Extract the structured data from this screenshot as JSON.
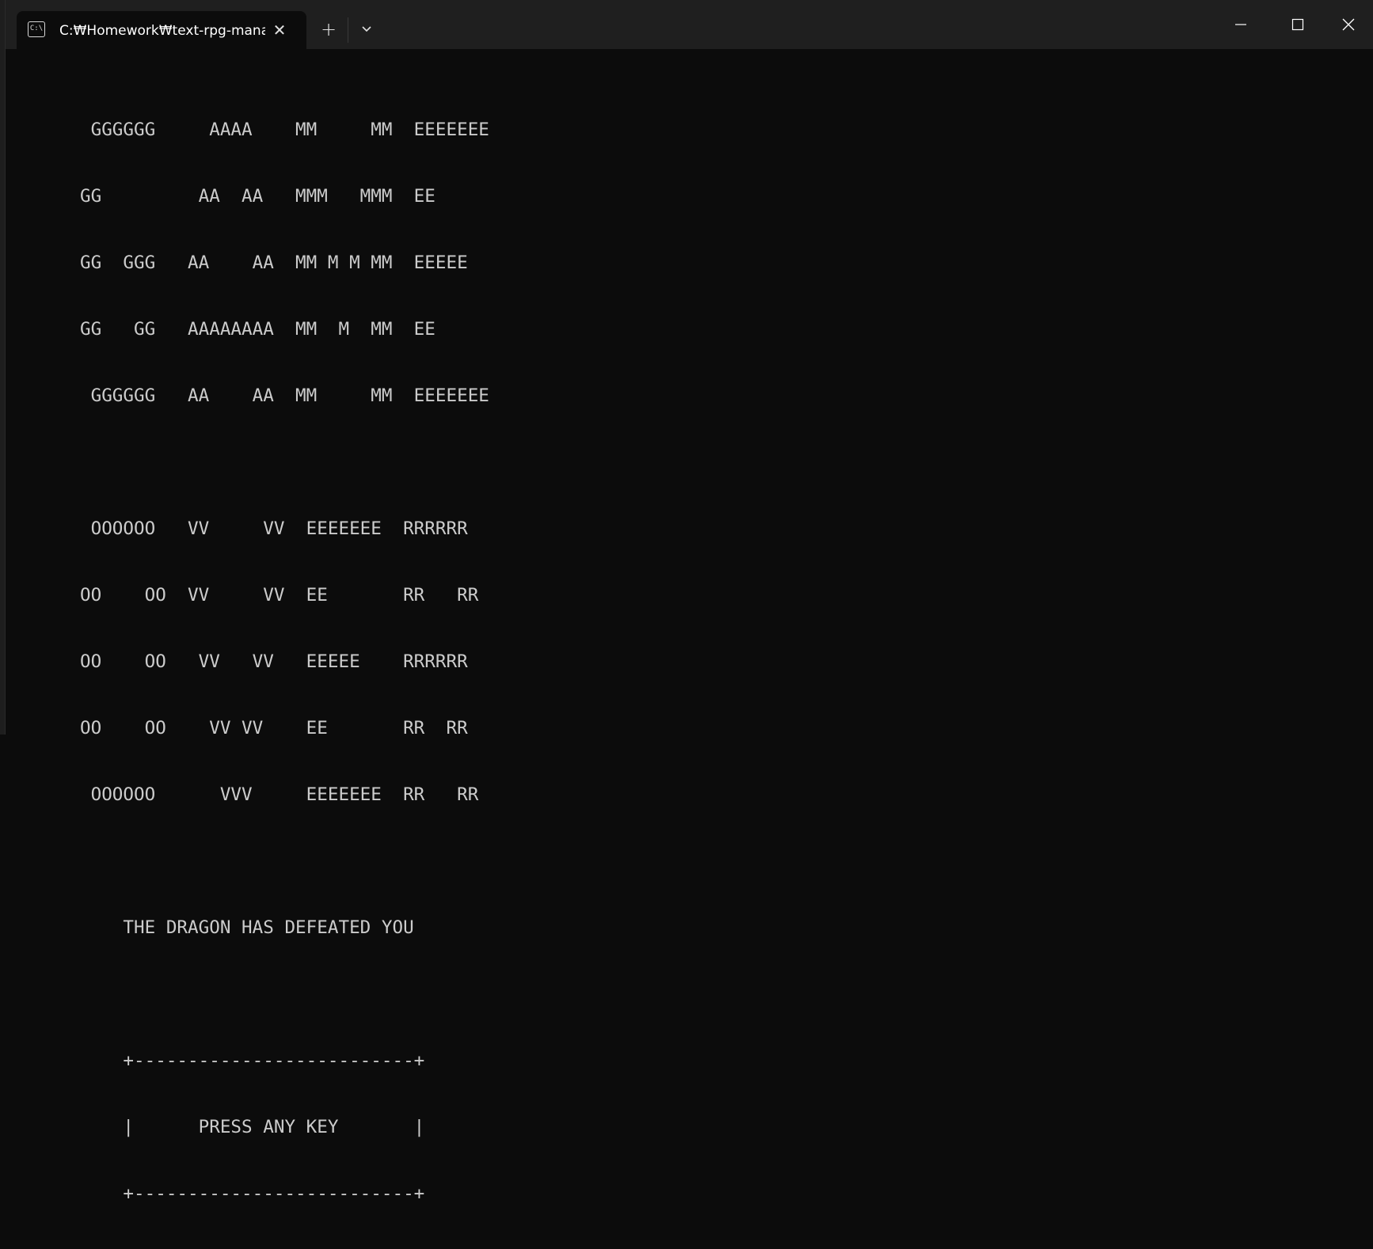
{
  "window": {
    "tab_title": "C:₩Homework₩text-rpg-manager",
    "tab_icon_text": "C:\\",
    "new_tab_label": "+",
    "close_tab_label": "✕"
  },
  "icons": {
    "tab": "terminal-icon",
    "close_tab": "close-icon",
    "new_tab": "plus-icon",
    "dropdown": "chevron-down-icon",
    "minimize": "minimize-icon",
    "maximize": "maximize-icon",
    "close_window": "close-icon"
  },
  "terminal": {
    "lines": [
      " GGGGGG     AAAA    MM     MM  EEEEEEE",
      "GG         AA  AA   MMM   MMM  EE",
      "GG  GGG   AA    AA  MM M M MM  EEEEE",
      "GG   GG   AAAAAAAA  MM  M  MM  EE",
      " GGGGGG   AA    AA  MM     MM  EEEEEEE",
      "",
      " OOOOOO   VV     VV  EEEEEEE  RRRRRR",
      "OO    OO  VV     VV  EE       RR   RR",
      "OO    OO   VV   VV   EEEEE    RRRRRR",
      "OO    OO    VV VV    EE       RR  RR",
      " OOOOOO      VVV     EEEEEEE  RR   RR",
      "",
      "    THE DRAGON HAS DEFEATED YOU",
      "",
      "    +--------------------------+",
      "    |      PRESS ANY KEY       |",
      "    +--------------------------+"
    ]
  },
  "colors": {
    "background": "#0c0c0c",
    "titlebar": "#1f1f1f",
    "text": "#cccccc"
  }
}
